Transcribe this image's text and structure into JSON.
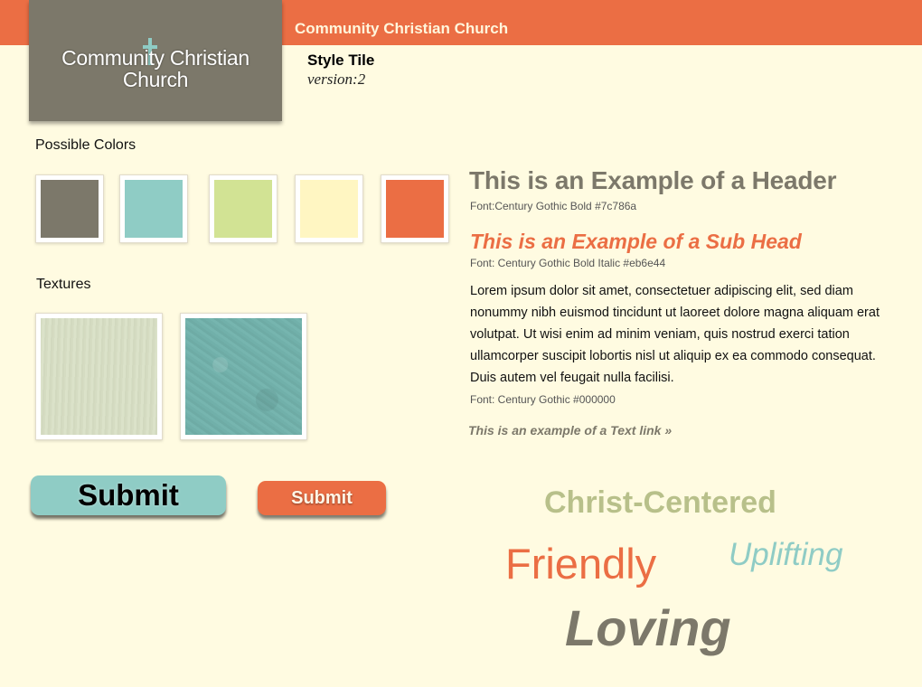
{
  "header": {
    "site_title": "Community Christian Church",
    "logo_line1": "Community Christian",
    "logo_line2": "Church",
    "style_tile_label": "Style Tile",
    "version_label": "version:2"
  },
  "colors_section": {
    "label": "Possible Colors",
    "swatches": [
      {
        "hex": "#7c786a"
      },
      {
        "hex": "#8fccc5"
      },
      {
        "hex": "#d2e394"
      },
      {
        "hex": "#fff6c2"
      },
      {
        "hex": "#eb6e44"
      }
    ]
  },
  "textures_section": {
    "label": "Textures"
  },
  "typography": {
    "header_example": "This is an Example of a Header",
    "header_font_note": "Font:Century Gothic Bold #7c786a",
    "subhead_example": "This is an Example of a Sub Head",
    "subhead_font_note": "Font: Century Gothic Bold Italic #eb6e44",
    "body_example": "Lorem ipsum dolor sit amet, consectetuer adipiscing elit, sed diam nonummy nibh euismod tincidunt ut laoreet dolore magna aliquam erat volutpat. Ut wisi enim ad minim veniam, quis nostrud exerci tation ullamcorper suscipit lobortis nisl ut aliquip ex ea commodo consequat. Duis autem vel feugait nulla facilisi.",
    "body_font_note": "Font: Century Gothic #000000",
    "text_link": "This is an example of a Text link »"
  },
  "buttons": {
    "big_submit": "Submit",
    "small_submit": "Submit"
  },
  "adjectives": {
    "christ_centered": "Christ-Centered",
    "friendly": "Friendly",
    "uplifting": "Uplifting",
    "loving": "Loving"
  },
  "brand_colors": {
    "gray": "#7c786a",
    "teal": "#8fccc5",
    "green": "#d2e394",
    "cream": "#fff6c2",
    "orange": "#eb6e44"
  }
}
